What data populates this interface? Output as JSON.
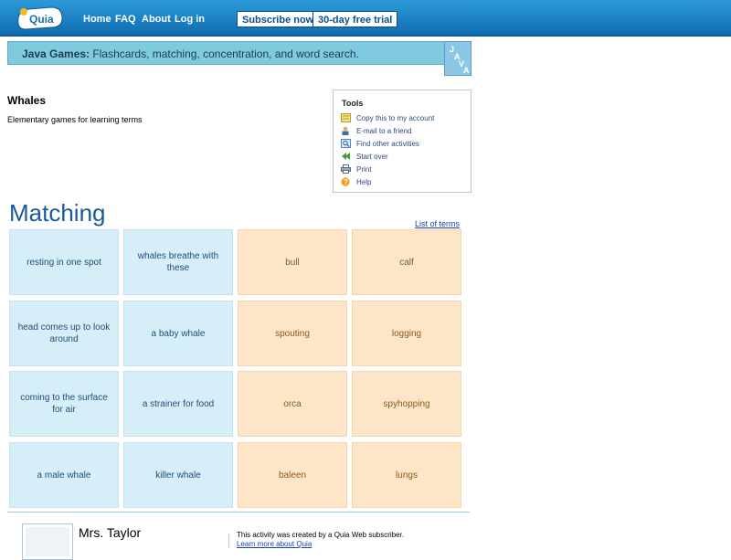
{
  "nav": {
    "logo": "Quia",
    "links": [
      "Home",
      "FAQ",
      "About",
      "Log in"
    ],
    "subscribe_label": "Subscribe now",
    "trial_label": "30-day free trial"
  },
  "banner": {
    "bold": "Java Games:",
    "text": " Flashcards, matching, concentration, and word search.",
    "logo_letters": [
      "J",
      "A",
      "V",
      "A"
    ]
  },
  "activity": {
    "title": "Whales",
    "description": "Elementary games for learning terms"
  },
  "tools": {
    "title": "Tools",
    "items": [
      {
        "label": "Copy this to my account",
        "icon": "copy-icon",
        "color": "#d8c24a"
      },
      {
        "label": "E-mail to a friend",
        "icon": "person-mail-icon",
        "color": "#3c6fa8"
      },
      {
        "label": "Find other activities",
        "icon": "find-icon",
        "color": "#4a86c8"
      },
      {
        "label": "Start over",
        "icon": "start-over-icon",
        "color": "#3f9a3f"
      },
      {
        "label": "Print",
        "icon": "printer-icon",
        "color": "#5a6a7a"
      },
      {
        "label": "Help",
        "icon": "help-icon",
        "color": "#f2a11a"
      }
    ]
  },
  "matching": {
    "heading": "Matching",
    "list_link": "List of terms",
    "rows": [
      [
        "resting in one spot",
        "whales breathe with these",
        "bull",
        "calf"
      ],
      [
        "head comes up to look around",
        "a baby whale",
        "spouting",
        "logging"
      ],
      [
        "coming to the surface for air",
        "a strainer for food",
        "orca",
        "spyhopping"
      ],
      [
        "a male whale",
        "killer whale",
        "baleen",
        "lungs"
      ]
    ]
  },
  "footer": {
    "author": "Mrs. Taylor",
    "created": "This activity was created by a Quia Web subscriber.",
    "learn_more": "Learn more about Quia"
  },
  "colors": {
    "nav_bar": "#1b7fc2",
    "banner": "#7fcadf",
    "question_card": "#d6eef8",
    "answer_card": "#fde5c8",
    "heading": "#1b5a9a"
  }
}
